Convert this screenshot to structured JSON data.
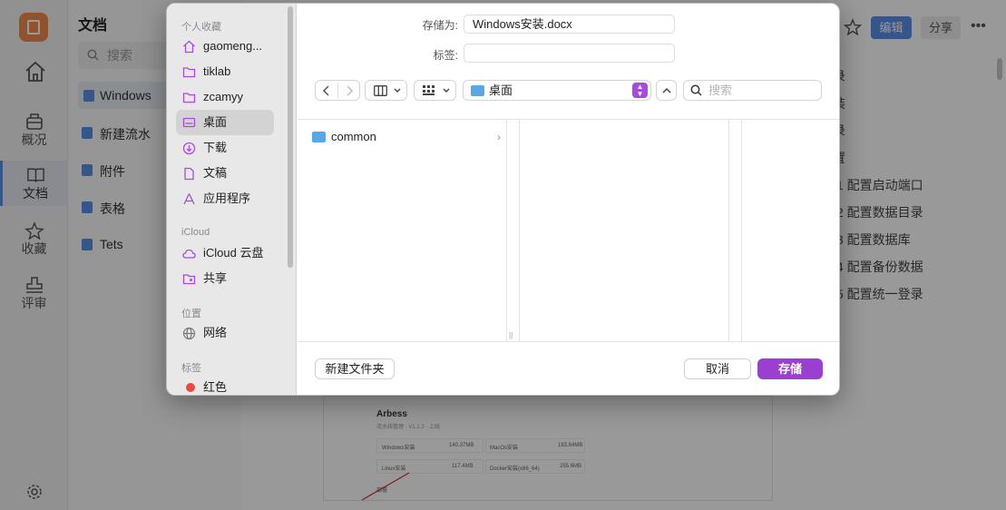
{
  "app": {
    "rail": {
      "items": [
        {
          "label": "概况",
          "icon": "briefcase-icon"
        },
        {
          "label": "文档",
          "icon": "book-icon"
        },
        {
          "label": "收藏",
          "icon": "star-icon"
        },
        {
          "label": "评审",
          "icon": "stamp-icon"
        }
      ]
    },
    "doclist": {
      "title": "文档",
      "search_placeholder": "搜索",
      "items": [
        "Windows",
        "新建流水",
        "附件",
        "表格",
        "Tets"
      ]
    },
    "toolbar": {
      "edit_label": "编辑",
      "share_label": "分享",
      "more_label": "•••"
    },
    "toc": [
      "录",
      "装",
      "录",
      "置",
      ".1 配置启动端口",
      ".2 配置数据目录",
      ".3 配置数据库",
      ".4 配置备份数据",
      ".5 配置统一登录"
    ],
    "embed": {
      "title": "Arbess",
      "subtitle": "流水线管理 · V1.2.2 · 上线",
      "rows": [
        {
          "name": "Windows安装",
          "size": "140.37MB"
        },
        {
          "name": "MacOs安装",
          "size": "183.84MB"
        },
        {
          "name": "Linux安装",
          "size": "117.4MB"
        },
        {
          "name": "Docker安装(x86_64)",
          "size": "255.6MB"
        }
      ],
      "footer": "部署"
    }
  },
  "dialog": {
    "save_as_label": "存储为:",
    "filename": "Windows安装.docx",
    "tags_label": "标签:",
    "tags_value": "",
    "location": "桌面",
    "search_placeholder": "搜索",
    "sidebar": {
      "favorites_header": "个人收藏",
      "favorites": [
        {
          "label": "gaomeng...",
          "icon": "home-icon"
        },
        {
          "label": "tiklab",
          "icon": "folder-icon"
        },
        {
          "label": "zcamyy",
          "icon": "folder-icon"
        },
        {
          "label": "桌面",
          "icon": "desktop-icon"
        },
        {
          "label": "下载",
          "icon": "download-icon"
        },
        {
          "label": "文稿",
          "icon": "document-icon"
        },
        {
          "label": "应用程序",
          "icon": "apps-icon"
        }
      ],
      "icloud_header": "iCloud",
      "icloud": [
        {
          "label": "iCloud 云盘",
          "icon": "cloud-icon"
        },
        {
          "label": "共享",
          "icon": "shared-folder-icon"
        }
      ],
      "locations_header": "位置",
      "locations": [
        {
          "label": "网络",
          "icon": "globe-icon"
        }
      ],
      "tags_header": "标签",
      "tags": [
        {
          "label": "红色",
          "color": "#eb4b3f"
        }
      ]
    },
    "browser_items": [
      "common"
    ],
    "new_folder_label": "新建文件夹",
    "cancel_label": "取消",
    "save_label": "存储"
  },
  "colors": {
    "accent": "#5b8ee6",
    "save_button": "#9b3fd1",
    "folder": "#58a8e8",
    "logo": "#f08a4b"
  }
}
